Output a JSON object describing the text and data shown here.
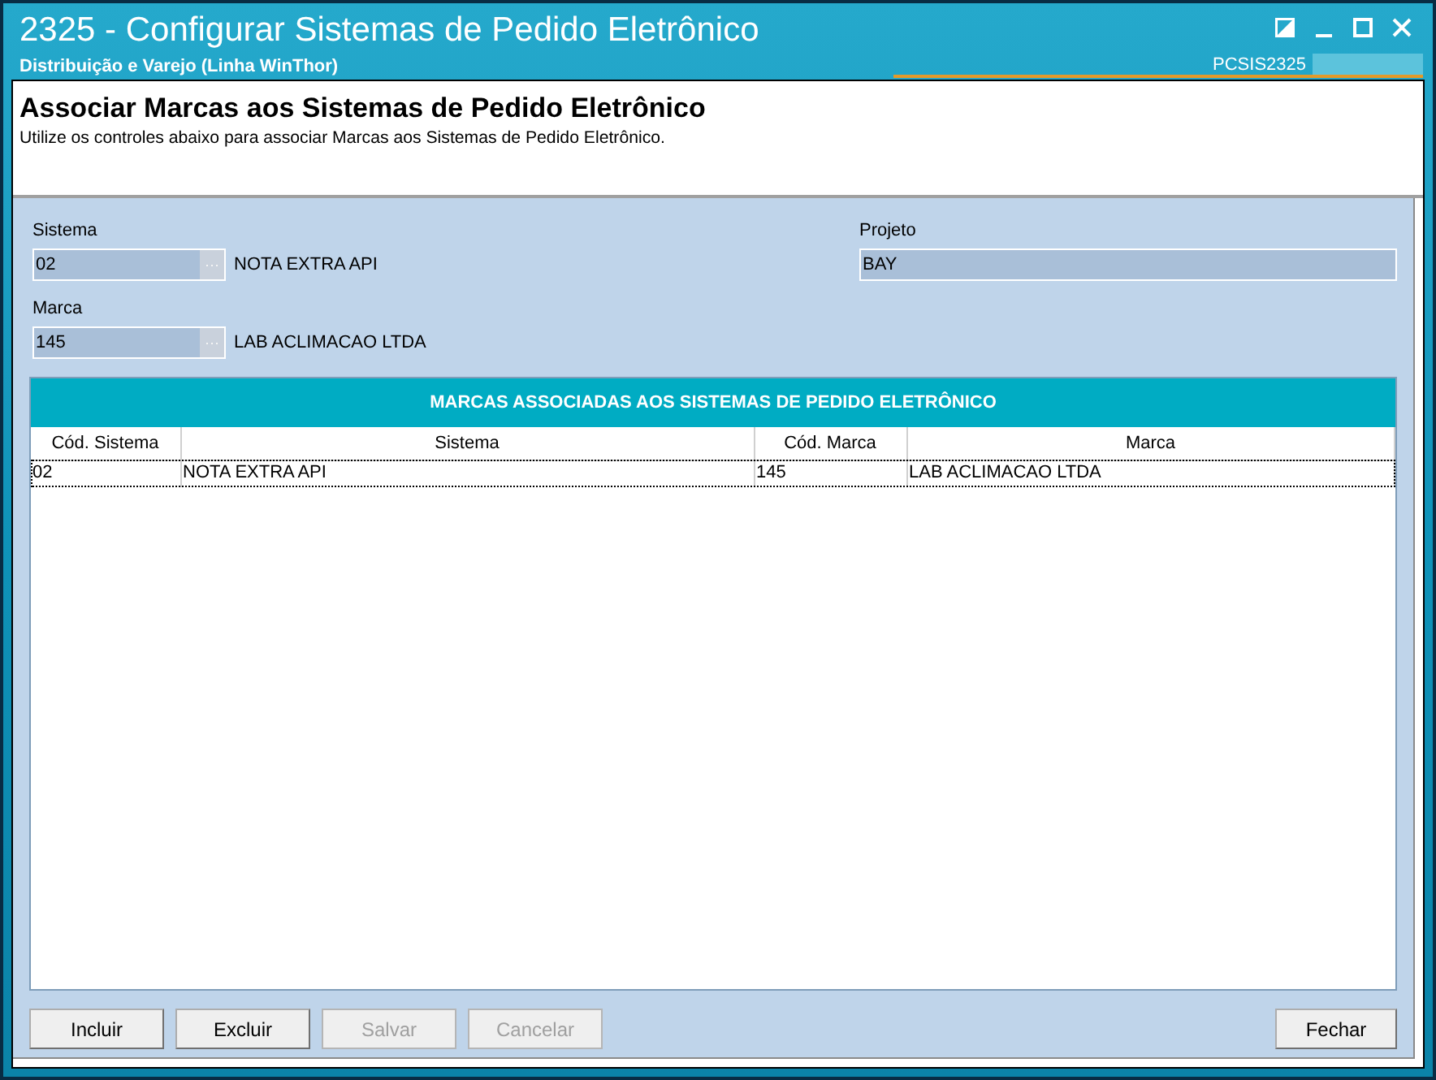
{
  "window": {
    "title": "2325 - Configurar Sistemas de Pedido Eletrônico",
    "subtitle": "Distribuição e Varejo (Linha WinThor)",
    "routine_code": "PCSIS2325"
  },
  "header": {
    "title": "Associar Marcas aos Sistemas de Pedido Eletrônico",
    "description": "Utilize os controles abaixo para associar Marcas aos Sistemas de Pedido Eletrônico."
  },
  "form": {
    "fields": [
      {
        "kind": "lookup",
        "label": "Sistema",
        "value": "02",
        "description": "NOTA EXTRA API"
      },
      {
        "kind": "text",
        "label": "Projeto",
        "value": "BAY"
      },
      {
        "kind": "lookup",
        "label": "Marca",
        "value": "145",
        "description": "LAB ACLIMACAO LTDA"
      }
    ]
  },
  "table": {
    "title": "MARCAS ASSOCIADAS AOS SISTEMAS DE PEDIDO ELETRÔNICO",
    "columns": [
      "Cód. Sistema",
      "Sistema",
      "Cód. Marca",
      "Marca"
    ],
    "rows": [
      {
        "cells": [
          "02",
          "NOTA EXTRA API",
          "145",
          "LAB ACLIMACAO LTDA"
        ],
        "selected": true
      }
    ]
  },
  "buttons": [
    {
      "label": "Incluir",
      "disabled": false
    },
    {
      "label": "Excluir",
      "disabled": false
    },
    {
      "label": "Salvar",
      "disabled": true
    },
    {
      "label": "Cancelar",
      "disabled": true
    }
  ],
  "close_button": {
    "label": "Fechar",
    "disabled": false
  }
}
